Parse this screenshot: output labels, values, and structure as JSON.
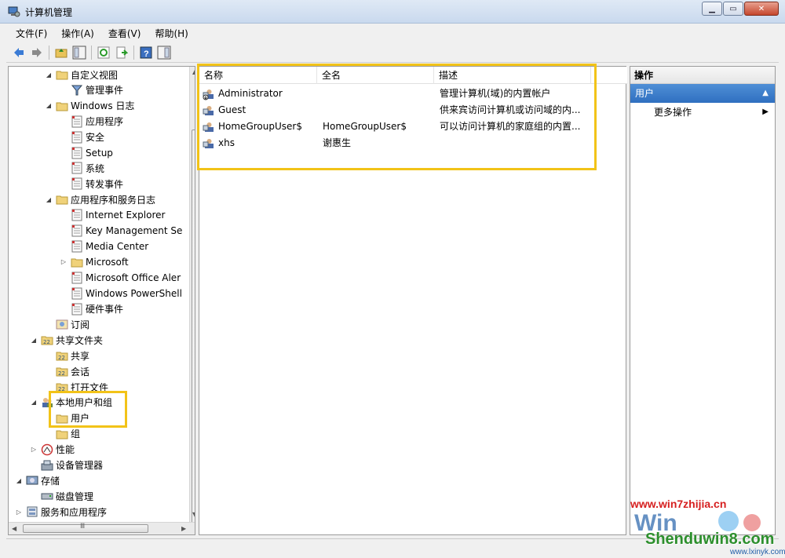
{
  "window": {
    "title": "计算机管理"
  },
  "menu": [
    "文件(F)",
    "操作(A)",
    "查看(V)",
    "帮助(H)"
  ],
  "toolbar_icons": [
    "back-arrow-icon",
    "forward-arrow-icon",
    "up-folder-icon",
    "show-hide-tree-icon",
    "refresh-icon",
    "export-list-icon",
    "help-icon",
    "show-hide-action-pane-icon"
  ],
  "tree": [
    {
      "label": "自定义视图",
      "indent": 2,
      "twisty": "◢",
      "icon": "folder-icon"
    },
    {
      "label": "管理事件",
      "indent": 3,
      "twisty": "",
      "icon": "filter-icon"
    },
    {
      "label": "Windows 日志",
      "indent": 2,
      "twisty": "◢",
      "icon": "folder-icon"
    },
    {
      "label": "应用程序",
      "indent": 3,
      "twisty": "",
      "icon": "log-icon"
    },
    {
      "label": "安全",
      "indent": 3,
      "twisty": "",
      "icon": "log-icon"
    },
    {
      "label": "Setup",
      "indent": 3,
      "twisty": "",
      "icon": "log-icon"
    },
    {
      "label": "系统",
      "indent": 3,
      "twisty": "",
      "icon": "log-icon"
    },
    {
      "label": "转发事件",
      "indent": 3,
      "twisty": "",
      "icon": "log-icon"
    },
    {
      "label": "应用程序和服务日志",
      "indent": 2,
      "twisty": "◢",
      "icon": "folder-icon"
    },
    {
      "label": "Internet Explorer",
      "indent": 3,
      "twisty": "",
      "icon": "log-icon"
    },
    {
      "label": "Key Management Se",
      "indent": 3,
      "twisty": "",
      "icon": "log-icon"
    },
    {
      "label": "Media Center",
      "indent": 3,
      "twisty": "",
      "icon": "log-icon"
    },
    {
      "label": "Microsoft",
      "indent": 3,
      "twisty": "▷",
      "icon": "folder-icon"
    },
    {
      "label": "Microsoft Office Aler",
      "indent": 3,
      "twisty": "",
      "icon": "log-icon"
    },
    {
      "label": "Windows PowerShell",
      "indent": 3,
      "twisty": "",
      "icon": "log-icon"
    },
    {
      "label": "硬件事件",
      "indent": 3,
      "twisty": "",
      "icon": "log-icon"
    },
    {
      "label": "订阅",
      "indent": 2,
      "twisty": "",
      "icon": "subscription-icon"
    },
    {
      "label": "共享文件夹",
      "indent": 1,
      "twisty": "◢",
      "icon": "shared-folder-icon"
    },
    {
      "label": "共享",
      "indent": 2,
      "twisty": "",
      "icon": "shared-folder-icon"
    },
    {
      "label": "会话",
      "indent": 2,
      "twisty": "",
      "icon": "shared-folder-icon"
    },
    {
      "label": "打开文件",
      "indent": 2,
      "twisty": "",
      "icon": "shared-folder-icon"
    },
    {
      "label": "本地用户和组",
      "indent": 1,
      "twisty": "◢",
      "icon": "users-group-icon"
    },
    {
      "label": "用户",
      "indent": 2,
      "twisty": "",
      "icon": "folder-icon",
      "selected": true
    },
    {
      "label": "组",
      "indent": 2,
      "twisty": "",
      "icon": "folder-icon"
    },
    {
      "label": "性能",
      "indent": 1,
      "twisty": "▷",
      "icon": "performance-icon"
    },
    {
      "label": "设备管理器",
      "indent": 1,
      "twisty": "",
      "icon": "device-manager-icon"
    },
    {
      "label": "存储",
      "indent": 0,
      "twisty": "◢",
      "icon": "storage-icon"
    },
    {
      "label": "磁盘管理",
      "indent": 1,
      "twisty": "",
      "icon": "disk-icon"
    },
    {
      "label": "服务和应用程序",
      "indent": 0,
      "twisty": "▷",
      "icon": "services-icon"
    }
  ],
  "list": {
    "columns": [
      "名称",
      "全名",
      "描述"
    ],
    "rows": [
      {
        "name": "Administrator",
        "fullname": "",
        "description": "管理计算机(域)的内置帐户",
        "icon": "disabled-user-icon"
      },
      {
        "name": "Guest",
        "fullname": "",
        "description": "供来宾访问计算机或访问域的内...",
        "icon": "user-icon"
      },
      {
        "name": "HomeGroupUser$",
        "fullname": "HomeGroupUser$",
        "description": "可以访问计算机的家庭组的内置...",
        "icon": "user-icon"
      },
      {
        "name": "xhs",
        "fullname": "谢惠生",
        "description": "",
        "icon": "user-icon"
      }
    ]
  },
  "actions": {
    "header": "操作",
    "section": "用户",
    "items": [
      "更多操作"
    ]
  },
  "tree_scroll_glyph": "Ⅲ",
  "watermark": {
    "line1": "www.win7zhijia.cn",
    "line2": "Shenduwin8.com",
    "line3": "www.lxinyk.com"
  },
  "colors": {
    "highlight": "#f2c318",
    "selection": "#3a7bd5"
  }
}
